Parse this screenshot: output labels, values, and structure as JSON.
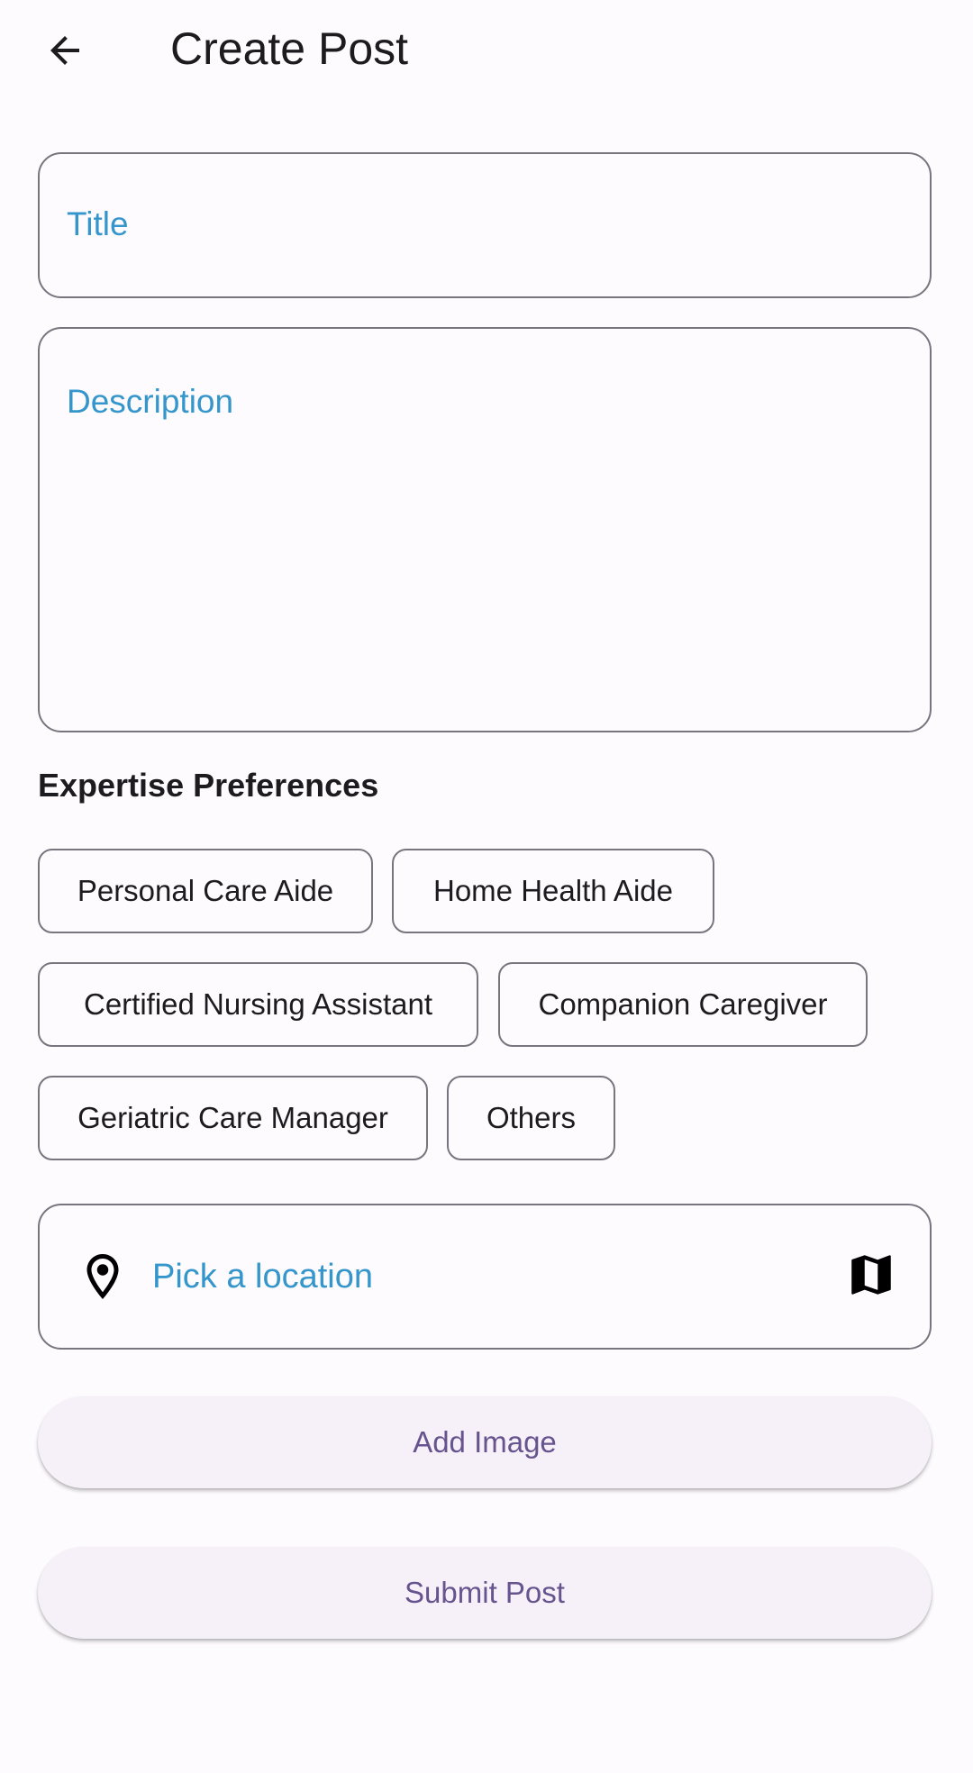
{
  "appbar": {
    "back_icon": "arrow-back-icon",
    "title": "Create Post"
  },
  "form": {
    "title_placeholder": "Title",
    "description_placeholder": "Description"
  },
  "expertise": {
    "heading": "Expertise Preferences",
    "chips": [
      "Personal Care Aide",
      "Home Health Aide",
      "Certified Nursing Assistant",
      "Companion Caregiver",
      "Geriatric Care Manager",
      "Others"
    ]
  },
  "location": {
    "pin_icon": "location-pin-icon",
    "label": "Pick a location",
    "map_icon": "map-icon"
  },
  "actions": {
    "add_image": "Add Image",
    "submit_post": "Submit Post"
  },
  "colors": {
    "background": "#fefbff",
    "placeholder_blue": "#3596cb",
    "outline": "#79747e",
    "button_text": "#67548e",
    "button_bg": "#f6f1f9"
  }
}
